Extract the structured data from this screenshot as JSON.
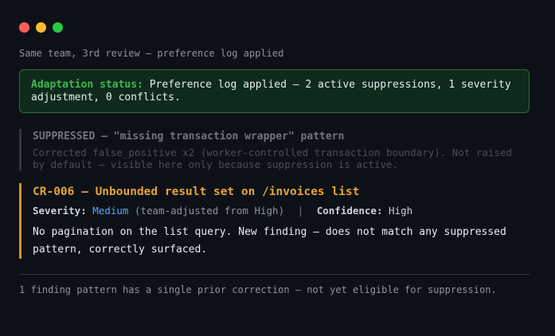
{
  "window": {
    "controls": {
      "close_color": "#ff5f57",
      "minimize_color": "#febc2e",
      "maximize_color": "#28c840"
    }
  },
  "subtitle": "Same team, 3rd review — preference log applied",
  "adaptation": {
    "label": "Adaptation status:",
    "text": "Preference log applied — 2 active suppressions, 1 severity adjustment, 0 conflicts."
  },
  "suppressed": {
    "title": "SUPPRESSED — \"missing transaction wrapper\" pattern",
    "body": "Corrected false_positive x2 (worker-controlled transaction boundary). Not raised by default — visible here only because suppression is active."
  },
  "finding": {
    "title": "CR-006 — Unbounded result set on /invoices list",
    "severity_label": "Severity:",
    "severity_value": "Medium",
    "severity_note": "(team-adjusted from High)",
    "separator": "|",
    "confidence_label": "Confidence:",
    "confidence_value": "High",
    "body": "No pagination on the list query. New finding — does not match any suppressed pattern, correctly surfaced."
  },
  "footer": "1 finding pattern has a single prior correction — not yet eligible for suppression.",
  "colors": {
    "accent_green": "#3fb950",
    "accent_orange": "#e3a33a",
    "severity_blue": "#58a6ff"
  }
}
